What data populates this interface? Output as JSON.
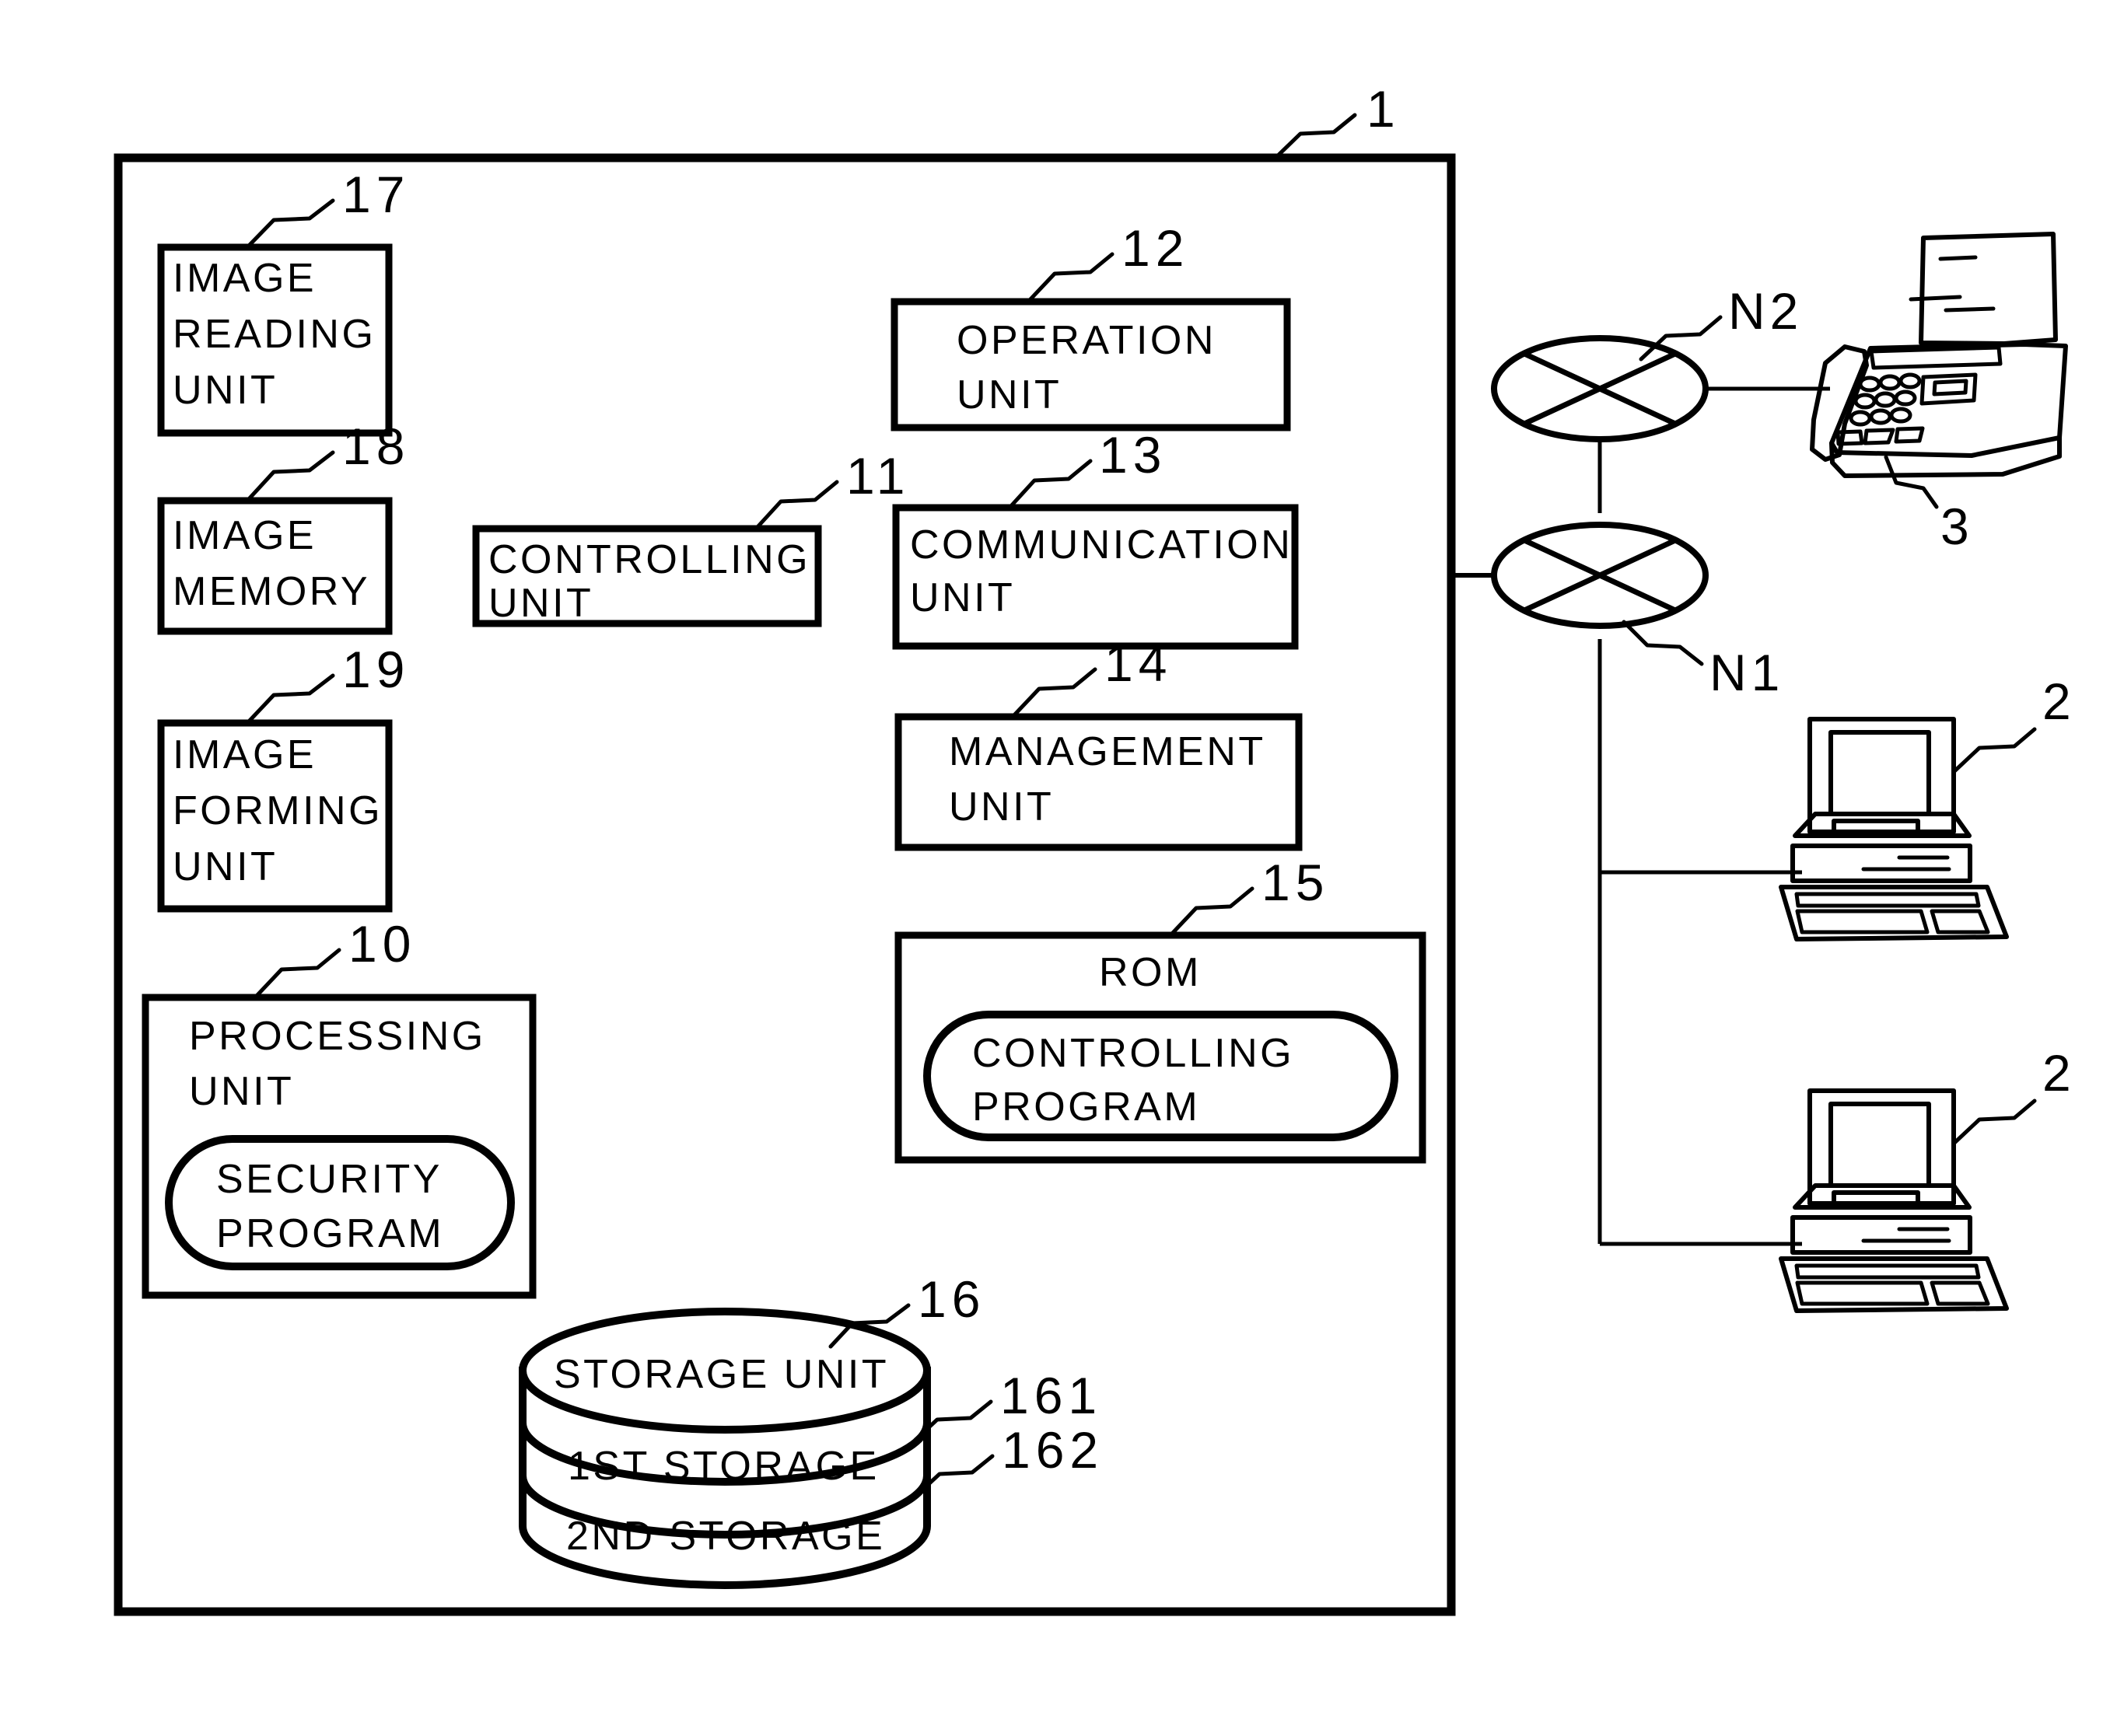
{
  "figure": {
    "title": "Image processing apparatus block diagram",
    "apparatus_ref": "1",
    "stroke_color": "#000000",
    "background_color": "#ffffff"
  },
  "apparatus": {
    "ref": "1",
    "blocks": [
      {
        "id": "image-reading-unit",
        "ref": "17",
        "lines": [
          "IMAGE",
          "READING",
          "UNIT"
        ]
      },
      {
        "id": "image-memory",
        "ref": "18",
        "lines": [
          "IMAGE",
          "MEMORY"
        ]
      },
      {
        "id": "image-forming-unit",
        "ref": "19",
        "lines": [
          "IMAGE",
          "FORMING",
          "UNIT"
        ]
      },
      {
        "id": "controlling-unit",
        "ref": "11",
        "lines": [
          "CONTROLLING",
          "UNIT"
        ]
      },
      {
        "id": "operation-unit",
        "ref": "12",
        "lines": [
          "OPERATION",
          "UNIT"
        ]
      },
      {
        "id": "communication-unit",
        "ref": "13",
        "lines": [
          "COMMUNICATION",
          "UNIT"
        ]
      },
      {
        "id": "management-unit",
        "ref": "14",
        "lines": [
          "MANAGEMENT",
          "UNIT"
        ]
      },
      {
        "id": "rom",
        "ref": "15",
        "lines": [
          "ROM"
        ]
      },
      {
        "id": "processing-unit",
        "ref": "10",
        "lines": [
          "PROCESSING",
          "UNIT"
        ]
      }
    ],
    "programs": [
      {
        "id": "controlling-program",
        "parent": "rom",
        "lines": [
          "CONTROLLING",
          "PROGRAM"
        ]
      },
      {
        "id": "security-program",
        "parent": "processing-unit",
        "lines": [
          "SECURITY",
          "PROGRAM"
        ]
      }
    ],
    "storage": {
      "id": "storage-unit",
      "ref": "16",
      "title": "STORAGE UNIT",
      "bands": [
        {
          "id": "first-storage",
          "ref": "161",
          "label": "1ST STORAGE"
        },
        {
          "id": "second-storage",
          "ref": "162",
          "label": "2ND STORAGE"
        }
      ]
    }
  },
  "networks": [
    {
      "id": "network-n2",
      "label": "N2"
    },
    {
      "id": "network-n1",
      "label": "N1"
    }
  ],
  "external_devices": [
    {
      "id": "fax-machine",
      "ref": "3",
      "kind": "fax-icon"
    },
    {
      "id": "computer-top",
      "ref": "2",
      "kind": "computer-icon"
    },
    {
      "id": "computer-bottom",
      "ref": "2",
      "kind": "computer-icon"
    }
  ],
  "refs": {
    "apparatus": "1",
    "processing_unit": "10",
    "controlling_unit": "11",
    "operation_unit": "12",
    "communication_unit": "13",
    "management_unit": "14",
    "rom": "15",
    "storage_unit": "16",
    "first_storage": "161",
    "second_storage": "162",
    "image_reading_unit": "17",
    "image_memory": "18",
    "image_forming_unit": "19",
    "fax": "3",
    "computer_top": "2",
    "computer_bottom": "2",
    "network_n1": "N1",
    "network_n2": "N2"
  }
}
